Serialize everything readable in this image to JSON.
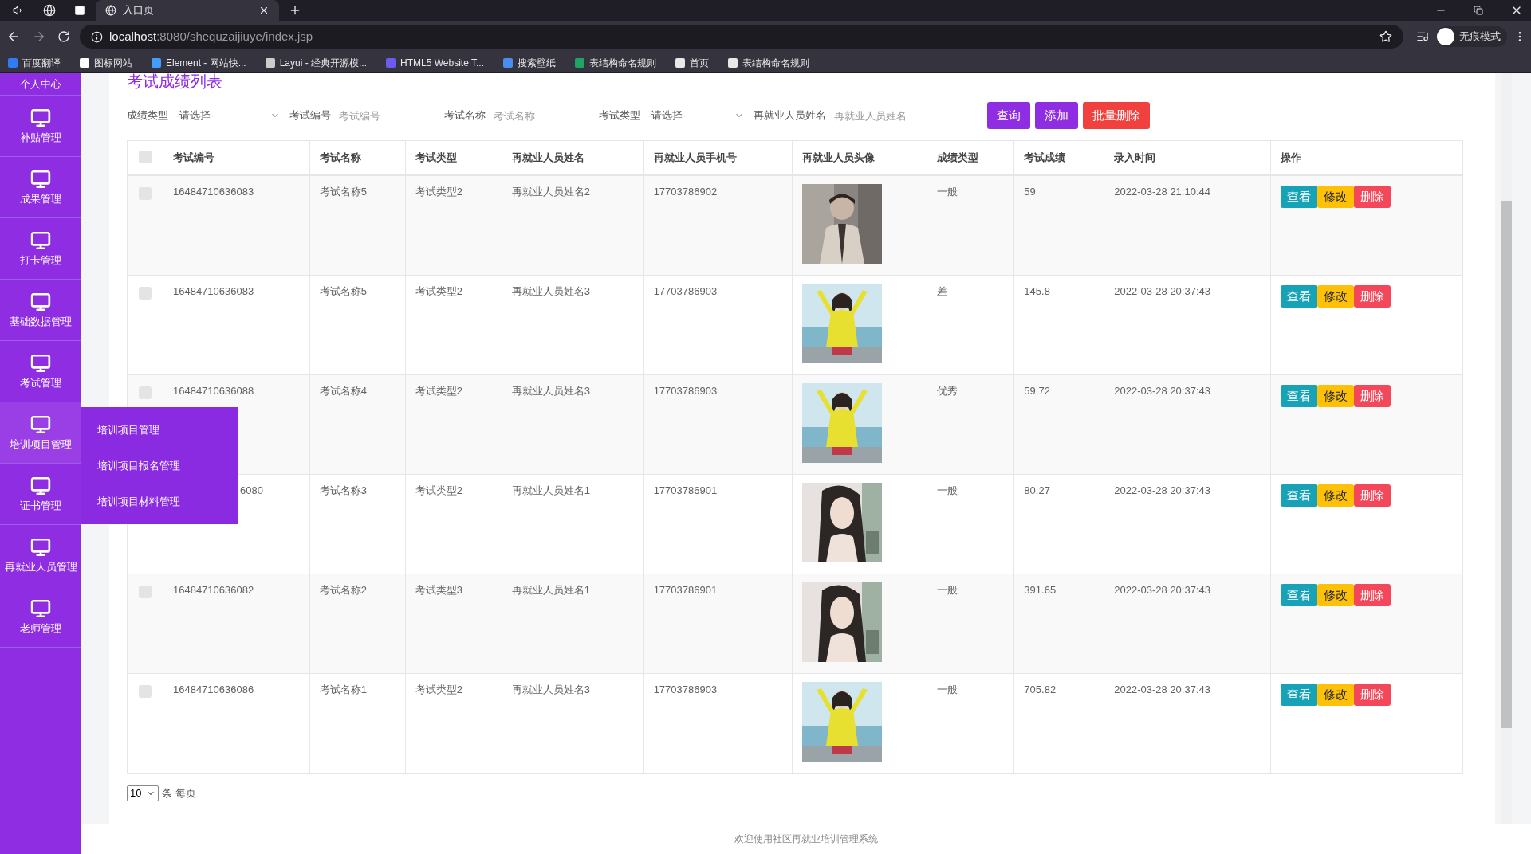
{
  "browser": {
    "tabs": [
      {
        "title": "入口页",
        "selected": true
      }
    ],
    "url_host": "localhost",
    "url_path": ":8080/shequzaijiuye/index.jsp",
    "profile": "无痕模式",
    "bookmarks": [
      {
        "label": "百度翻译",
        "color": "#2f7cf6"
      },
      {
        "label": "图标网站",
        "color": "#ffffff"
      },
      {
        "label": "Element - 网站快...",
        "color": "#409eff"
      },
      {
        "label": "Layui - 经典开源模...",
        "color": "#cccccc"
      },
      {
        "label": "HTML5 Website T...",
        "color": "#6b5bf0"
      },
      {
        "label": "搜索壁纸",
        "color": "#4a8cf0"
      },
      {
        "label": "表结构命名规则",
        "color": "#1fa463"
      },
      {
        "label": "首页",
        "color": "#e8e8e8"
      },
      {
        "label": "表结构命名规则",
        "color": "#e8e8e8"
      }
    ]
  },
  "sidebar": {
    "items": [
      {
        "label": "个人中心",
        "expanded": false
      },
      {
        "label": "补贴管理",
        "expanded": false
      },
      {
        "label": "成果管理",
        "expanded": false
      },
      {
        "label": "打卡管理",
        "expanded": false
      },
      {
        "label": "基础数据管理",
        "expanded": false
      },
      {
        "label": "考试管理",
        "expanded": false
      },
      {
        "label": "培训项目管理",
        "expanded": true,
        "children": [
          {
            "label": "培训项目管理"
          },
          {
            "label": "培训项目报名管理"
          },
          {
            "label": "培训项目材料管理"
          }
        ]
      },
      {
        "label": "证书管理",
        "expanded": false
      },
      {
        "label": "再就业人员管理",
        "expanded": false
      },
      {
        "label": "老师管理",
        "expanded": false
      }
    ]
  },
  "page": {
    "title": "考试成绩列表",
    "filters": [
      {
        "kind": "select",
        "label": "成绩类型",
        "value": "-请选择-"
      },
      {
        "kind": "input",
        "label": "考试编号",
        "placeholder": "考试编号"
      },
      {
        "kind": "input",
        "label": "考试名称",
        "placeholder": "考试名称"
      },
      {
        "kind": "select",
        "label": "考试类型",
        "value": "-请选择-"
      },
      {
        "kind": "input",
        "label": "再就业人员姓名",
        "placeholder": "再就业人员姓名"
      }
    ],
    "buttons": [
      {
        "label": "查询",
        "kind": "primary"
      },
      {
        "label": "添加",
        "kind": "primary"
      },
      {
        "label": "批量删除",
        "kind": "danger"
      }
    ]
  },
  "table": {
    "header_checked": false,
    "columns": [
      "考试编号",
      "考试名称",
      "考试类型",
      "再就业人员姓名",
      "再就业人员手机号",
      "再就业人员头像",
      "成绩类型",
      "考试成绩",
      "录入时间",
      "操作"
    ],
    "rows": [
      {
        "checked": false,
        "code": "16484710636083",
        "name": "考试名称5",
        "type": "考试类型2",
        "person": "再就业人员姓名2",
        "phone": "17703786902",
        "grade": "一般",
        "score": "59",
        "time": "2022-03-28 21:10:44",
        "actions": [
          {
            "kind": "view",
            "label": "查看"
          },
          {
            "kind": "edit",
            "label": "修改"
          },
          {
            "kind": "delete",
            "label": "删除"
          }
        ]
      },
      {
        "checked": false,
        "code": "16484710636083",
        "name": "考试名称5",
        "type": "考试类型2",
        "person": "再就业人员姓名3",
        "phone": "17703786903",
        "grade": "差",
        "score": "145.8",
        "time": "2022-03-28 20:37:43",
        "actions": [
          {
            "kind": "view",
            "label": "查看"
          },
          {
            "kind": "edit",
            "label": "修改"
          },
          {
            "kind": "delete",
            "label": "删除"
          }
        ]
      },
      {
        "checked": false,
        "code": "16484710636088",
        "name": "考试名称4",
        "type": "考试类型2",
        "person": "再就业人员姓名3",
        "phone": "17703786903",
        "grade": "优秀",
        "score": "59.72",
        "time": "2022-03-28 20:37:43",
        "actions": [
          {
            "kind": "view",
            "label": "查看"
          },
          {
            "kind": "edit",
            "label": "修改"
          },
          {
            "kind": "delete",
            "label": "删除"
          }
        ]
      },
      {
        "code": "6080",
        "name": "考试名称3",
        "type": "考试类型2",
        "person": "再就业人员姓名1",
        "phone": "17703786901",
        "grade": "一般",
        "score": "80.27",
        "time": "2022-03-28 20:37:43",
        "actions": [
          {
            "kind": "view",
            "label": "查看"
          },
          {
            "kind": "edit",
            "label": "修改"
          },
          {
            "kind": "delete",
            "label": "删除"
          }
        ]
      },
      {
        "checked": false,
        "code": "16484710636082",
        "name": "考试名称2",
        "type": "考试类型3",
        "person": "再就业人员姓名1",
        "phone": "17703786901",
        "grade": "一般",
        "score": "391.65",
        "time": "2022-03-28 20:37:43",
        "actions": [
          {
            "kind": "view",
            "label": "查看"
          },
          {
            "kind": "edit",
            "label": "修改"
          },
          {
            "kind": "delete",
            "label": "删除"
          }
        ]
      },
      {
        "checked": false,
        "code": "16484710636086",
        "name": "考试名称1",
        "type": "考试类型2",
        "person": "再就业人员姓名3",
        "phone": "17703786903",
        "grade": "一般",
        "score": "705.82",
        "time": "2022-03-28 20:37:43",
        "actions": [
          {
            "kind": "view",
            "label": "查看"
          },
          {
            "kind": "edit",
            "label": "修改"
          },
          {
            "kind": "delete",
            "label": "删除"
          }
        ]
      }
    ]
  },
  "pagination": {
    "page_size": "10",
    "suffix": "条 每页"
  },
  "footer": "欢迎使用社区再就业培训管理系统"
}
